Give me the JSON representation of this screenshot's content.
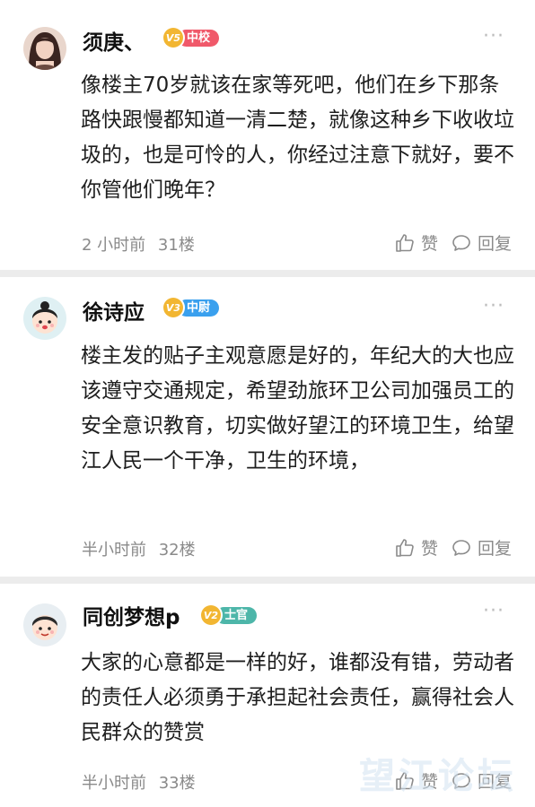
{
  "comments": [
    {
      "username": "须庚、",
      "level": "V5",
      "rank": "中校",
      "rank_color": "#f0596a",
      "text": "像楼主70岁就该在家等死吧，他们在乡下那条路快跟慢都知道一清二楚，就像这种乡下收收垃圾的，也是可怜的人，你经过注意下就好，要不你管他们晚年？",
      "time": "2 小时前",
      "floor": "31楼",
      "like_label": "赞",
      "reply_label": "回复",
      "more_icon": "more-dots-icon"
    },
    {
      "username": "徐诗应",
      "level": "V3",
      "rank": "中尉",
      "rank_color": "#3aa0ee",
      "text": "楼主发的贴子主观意愿是好的，年纪大的大也应该遵守交通规定，希望劲旅环卫公司加强员工的安全意识教育，切实做好望江的环境卫生，给望江人民一个干净，卫生的环境，",
      "time": "半小时前",
      "floor": "32楼",
      "like_label": "赞",
      "reply_label": "回复",
      "more_icon": "more-dots-icon"
    },
    {
      "username": "同创梦想p",
      "level": "V2",
      "rank": "士官",
      "rank_color": "#4db6a9",
      "text": "大家的心意都是一样的好，谁都没有错，劳动者的责任人必须勇于承担起社会责任，赢得社会人民群众的赞赏",
      "time": "半小时前",
      "floor": "33楼",
      "like_label": "赞",
      "reply_label": "回复",
      "more_icon": "more-dots-icon"
    }
  ],
  "watermark": "望江论坛"
}
